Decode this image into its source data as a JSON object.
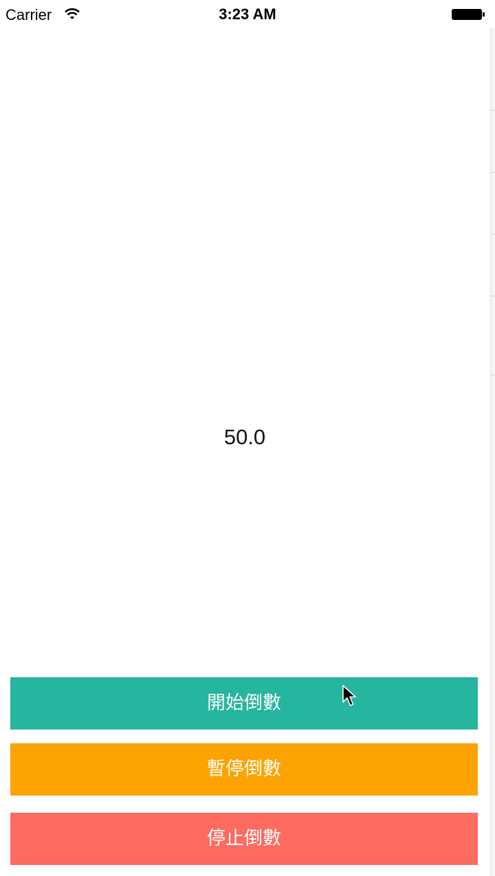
{
  "status_bar": {
    "carrier": "Carrier",
    "time": "3:23 AM"
  },
  "counter": {
    "value": "50.0"
  },
  "buttons": {
    "start_label": "開始倒數",
    "pause_label": "暫停倒數",
    "stop_label": "停止倒數"
  },
  "colors": {
    "start": "#26b59e",
    "pause": "#fca301",
    "stop": "#fd6a60"
  }
}
